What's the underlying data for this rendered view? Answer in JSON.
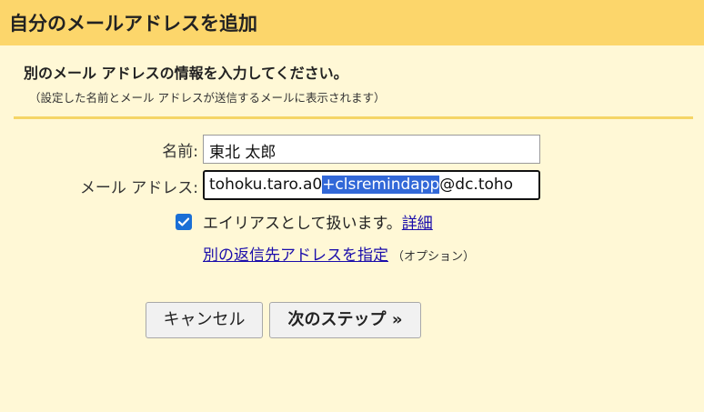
{
  "header": {
    "title": "自分のメールアドレスを追加"
  },
  "intro": {
    "title": "別のメール アドレスの情報を入力してください。",
    "subtitle": "（設定した名前とメール アドレスが送信するメールに表示されます）"
  },
  "form": {
    "name_label": "名前:",
    "name_value": "東北 太郎",
    "email_label": "メール アドレス:",
    "email_before_selection": "tohoku.taro.a0",
    "email_selected": "+clsremindapp",
    "email_after_selection": "@dc.toho"
  },
  "alias": {
    "checked": true,
    "text": "エイリアスとして扱います。",
    "details_link": "詳細"
  },
  "reply_to": {
    "link": "別の返信先アドレスを指定",
    "optional": "（オプション）"
  },
  "buttons": {
    "cancel": "キャンセル",
    "next": "次のステップ »"
  },
  "colors": {
    "header_bg": "#fcd66b",
    "body_bg": "#fff8d6",
    "selection": "#3268d8",
    "checkbox": "#1a6fd6",
    "link": "#1a0dab"
  }
}
